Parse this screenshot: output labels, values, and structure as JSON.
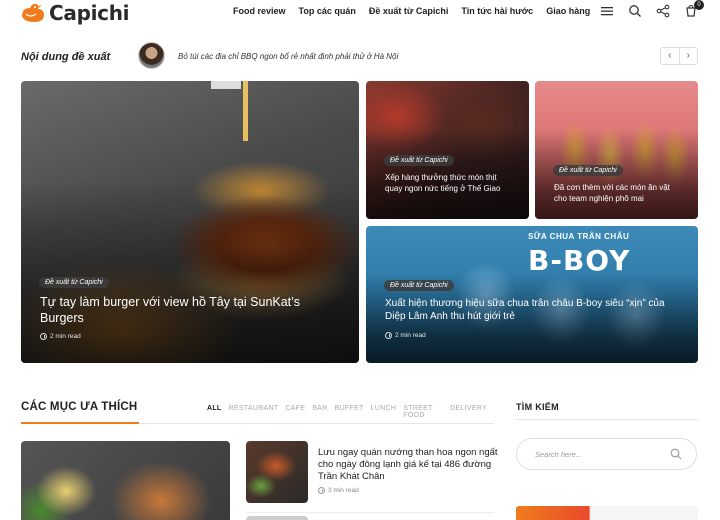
{
  "header": {
    "logo_text": "Capichi",
    "nav": [
      "Food review",
      "Top các quán",
      "Đề xuất từ Capichi",
      "Tin tức hài hước",
      "Giao hàng"
    ],
    "cart_count": "0",
    "icons": [
      "menu-icon",
      "search-icon",
      "share-icon",
      "cart-icon"
    ]
  },
  "featured": {
    "label": "Nội dung đề xuất",
    "text": "Bỏ túi các địa chỉ BBQ ngon bổ rẻ nhất định phải thử ở Hà Nội",
    "prev": "‹",
    "next": "›"
  },
  "hero": [
    {
      "badge": "Đề xuất từ Capichi",
      "title": "Tự tay làm burger với view hồ Tây tại SunKat’s Burgers",
      "meta": "2 min read"
    },
    {
      "badge": "Đề xuất từ Capichi",
      "title": "Xếp hàng thưởng thức món thịt quay ngon nức tiếng ở Thế Giao"
    },
    {
      "badge": "Đề xuất từ Capichi",
      "title": "Đã cơn thèm với các món ăn vặt cho team nghiện phô mai"
    },
    {
      "badge": "Đề xuất từ Capichi",
      "title": "Xuất hiện thương hiệu sữa chua trân châu B-boy siêu “xịn” của Diệp Lâm Anh thu hút giới trẻ",
      "meta": "2 min read",
      "image_sub": "SỮA CHUA TRÂN CHÂU",
      "image_title": "B-BOY"
    }
  ],
  "favorites": {
    "title": "CÁC MỤC ƯA THÍCH",
    "filters": [
      "ALL",
      "RESTAURANT",
      "CAFE",
      "BAR",
      "BUFFET",
      "LUNCH",
      "STREET FOOD",
      "DELIVERY"
    ],
    "post": {
      "title": "Lưu ngay quán nướng than hoa ngon ngất cho ngày đông lạnh giá kế tại 486 đường Trần Khát Chân",
      "meta": "3 min read"
    }
  },
  "sidebar": {
    "title": "TÌM KIẾM",
    "search_placeholder": "Search here..."
  },
  "colors": {
    "accent": "#f07c1e",
    "text": "#222222",
    "muted": "#aaaaaa"
  }
}
